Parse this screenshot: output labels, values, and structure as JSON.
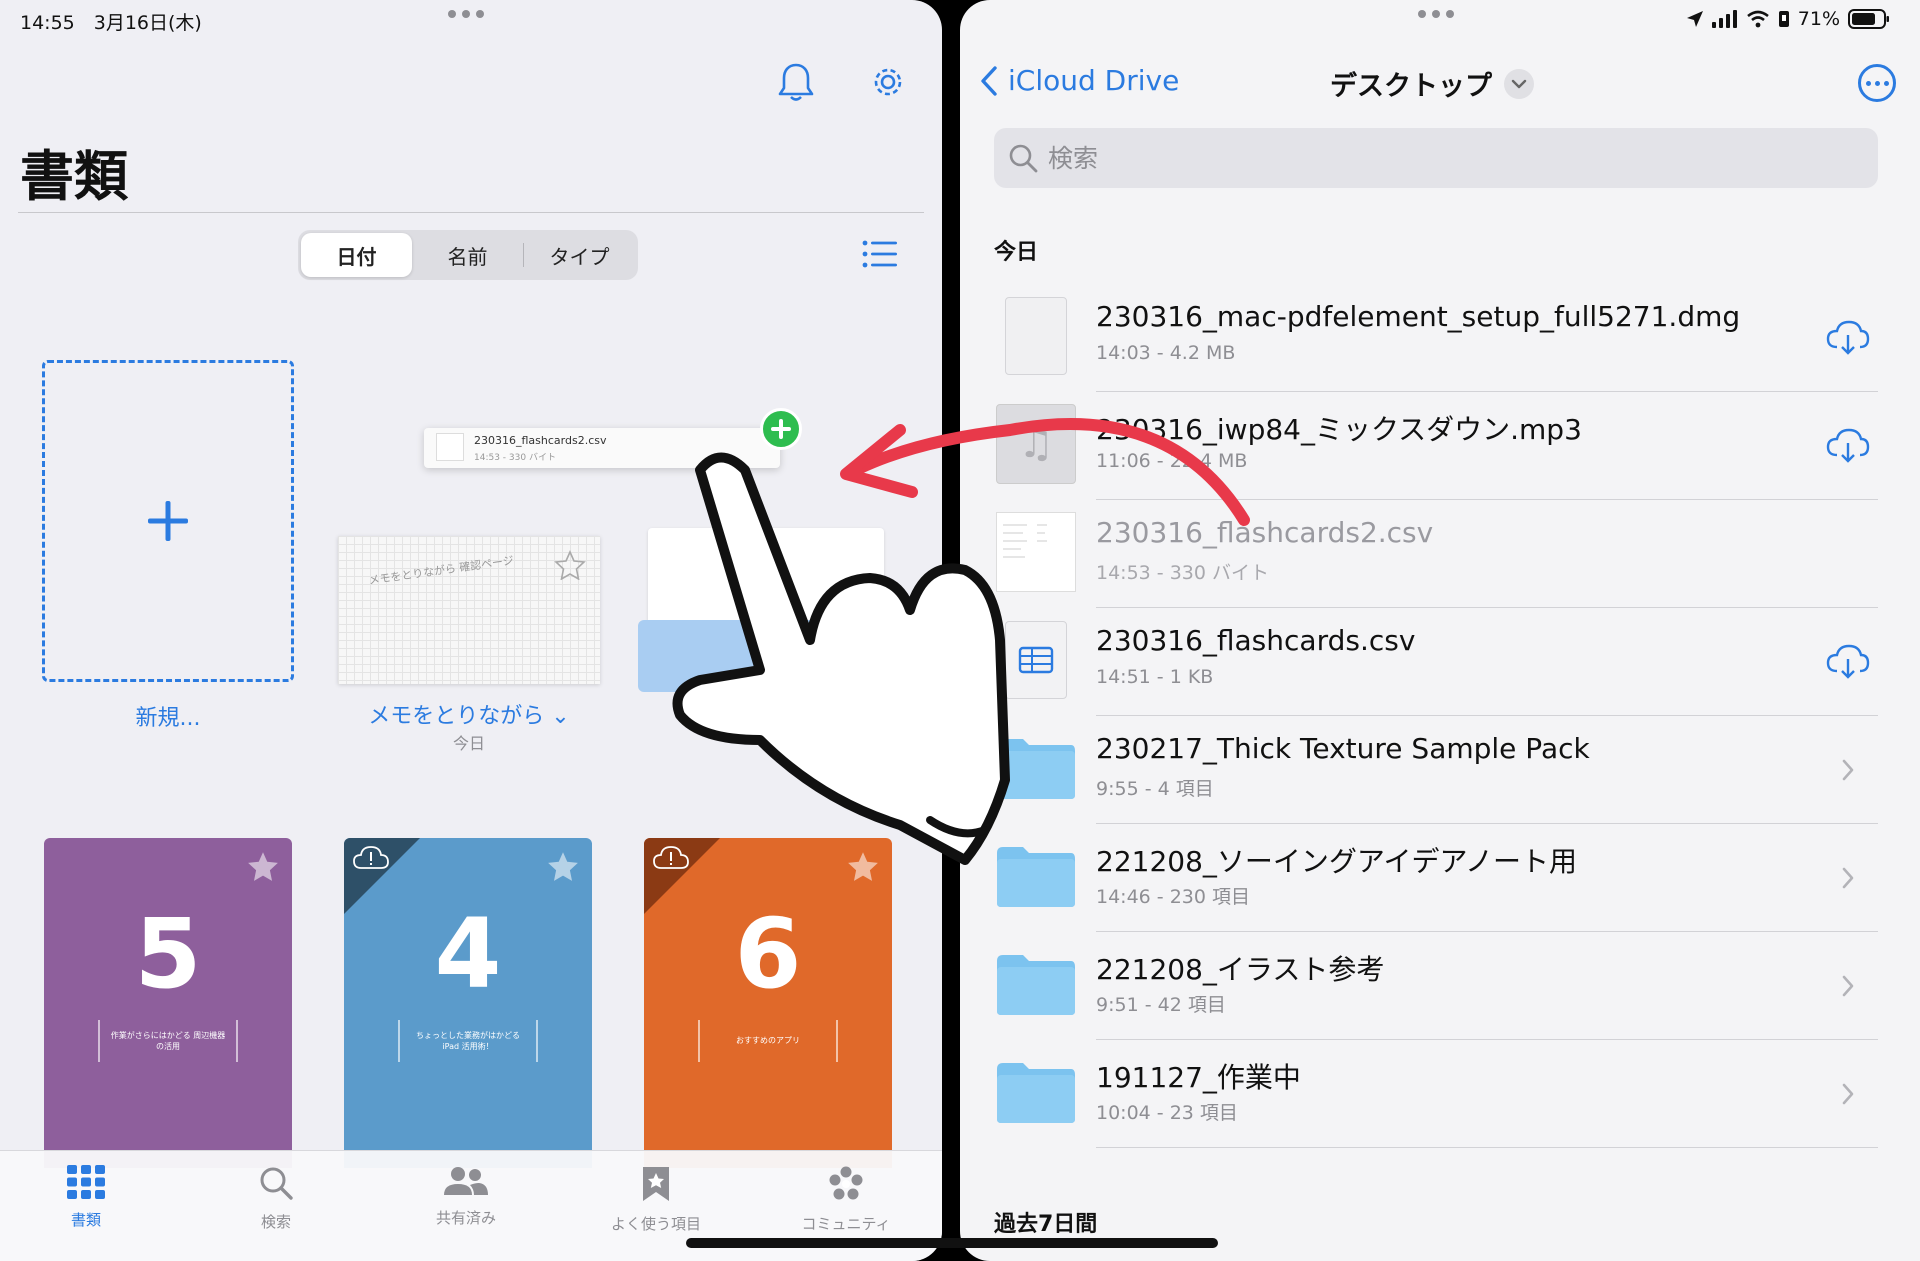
{
  "left": {
    "status_time": "14:55　3月16日(木)",
    "title": "書類",
    "sort_segments": [
      "日付",
      "名前",
      "タイプ"
    ],
    "new_label": "新規...",
    "drag_chip": {
      "name": "230316_flashcards2.csv",
      "meta": "14:53 - 330 バイト"
    },
    "memo": {
      "label": "メモをとりながら ⌄",
      "date": "今日",
      "scribble": "メモをとりながら 確認ページ"
    },
    "books": [
      {
        "number": "5",
        "subtitle": "作業がさらにはかどる 周辺機器の活用",
        "color": "#8e5f9c"
      },
      {
        "number": "4",
        "subtitle": "ちょっとした業務がはかどる iPad 活用術！",
        "color": "#5b9bcb",
        "corner": "#2e5068"
      },
      {
        "number": "6",
        "subtitle": "おすすめのアプリ",
        "color": "#e0692a",
        "corner": "#8b3a14"
      }
    ],
    "tabs": [
      "書類",
      "検索",
      "共有済み",
      "よく使う項目",
      "コミュニティ"
    ],
    "accent": "#2b7be0"
  },
  "right": {
    "status_battery": "71%",
    "back_label": "iCloud Drive",
    "title": "デスクトップ",
    "search_placeholder": "検索",
    "section_today": "今日",
    "section_week": "過去7日間",
    "files": [
      {
        "name": "230316_mac-pdfelement_setup_full5271.dmg",
        "meta": "14:03 - 4.2 MB",
        "icon": "document-icon",
        "trail": "cloud-download-icon"
      },
      {
        "name": "230316_iwp84_ミックスダウン.mp3",
        "meta": "11:06 - 22.4 MB",
        "icon": "audio-icon",
        "trail": "cloud-download-icon"
      },
      {
        "name": "230316_flashcards2.csv",
        "meta": "14:53 - 330 バイト",
        "icon": "csv-thumbnail",
        "trail": "none"
      },
      {
        "name": "230316_flashcards.csv",
        "meta": "14:51 - 1 KB",
        "icon": "table-icon",
        "trail": "cloud-download-icon"
      },
      {
        "name": "230217_Thick Texture Sample Pack",
        "meta": "9:55 - 4 項目",
        "icon": "folder-icon",
        "trail": "chevron-right-icon"
      },
      {
        "name": "221208_ソーイングアイデアノート用",
        "meta": "14:46 - 230 項目",
        "icon": "folder-icon",
        "trail": "chevron-right-icon"
      },
      {
        "name": "221208_イラスト参考",
        "meta": "9:51 - 42 項目",
        "icon": "folder-icon",
        "trail": "chevron-right-icon"
      },
      {
        "name": "191127_作業中",
        "meta": "10:04 - 23 項目",
        "icon": "folder-icon",
        "trail": "chevron-right-icon"
      }
    ],
    "folder_color": "#7cc3ef"
  }
}
